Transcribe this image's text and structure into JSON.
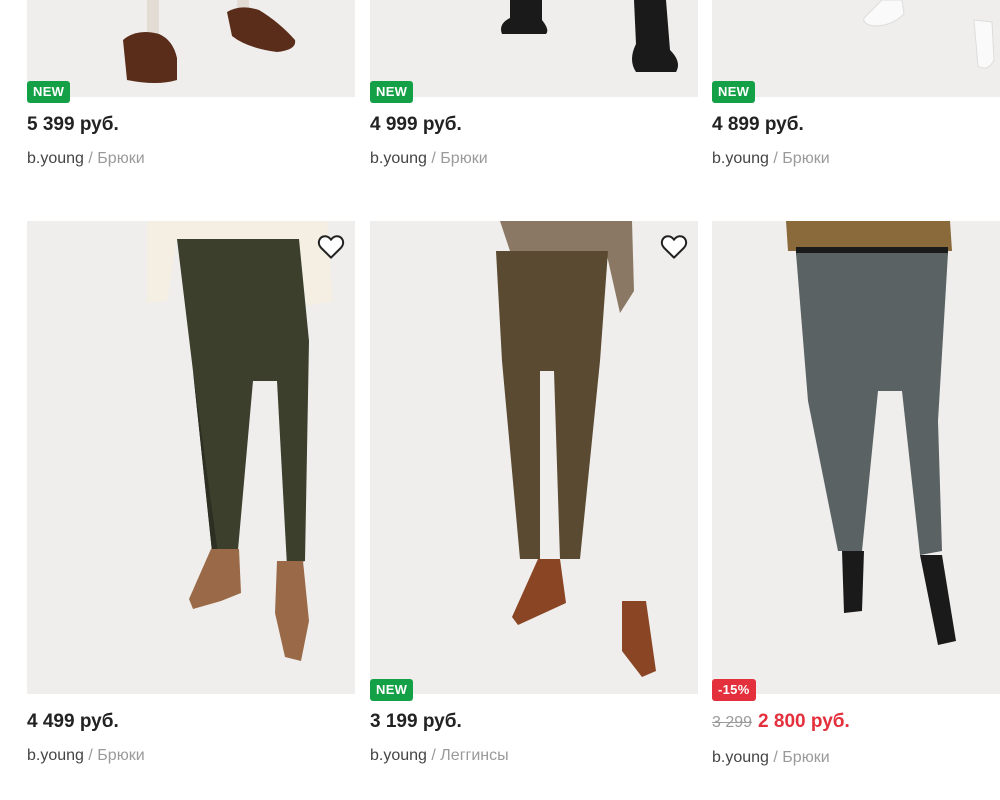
{
  "products": [
    {
      "badge": "NEW",
      "price": "5 399 руб.",
      "brand": "b.young",
      "sep": "/",
      "category": "Брюки"
    },
    {
      "badge": "NEW",
      "price": "4 999 руб.",
      "brand": "b.young",
      "sep": "/",
      "category": "Брюки"
    },
    {
      "badge": "NEW",
      "price": "4 899 руб.",
      "brand": "b.young",
      "sep": "/",
      "category": "Брюки"
    },
    {
      "badge": "",
      "price": "4 499 руб.",
      "brand": "b.young",
      "sep": "/",
      "category": "Брюки",
      "favorite_icon": "heart-outline-icon"
    },
    {
      "badge": "NEW",
      "price": "3 199 руб.",
      "brand": "b.young",
      "sep": "/",
      "category": "Леггинсы",
      "favorite_icon": "heart-outline-icon"
    },
    {
      "badge": "-15%",
      "old_price": "3 299",
      "price": "2 800 руб.",
      "brand": "b.young",
      "sep": "/",
      "category": "Брюки"
    }
  ],
  "colors": {
    "new_badge": "#14a046",
    "sale_badge": "#e4303c",
    "sale_price": "#e4303c"
  }
}
